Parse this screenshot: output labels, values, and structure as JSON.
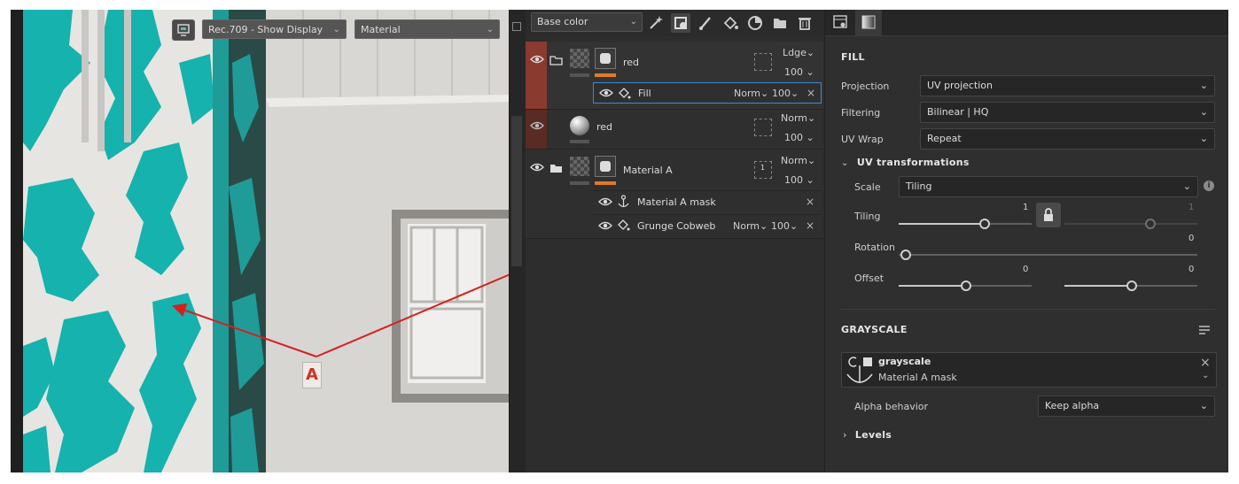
{
  "viewport": {
    "colorspace": "Rec.709 - Show Display",
    "mode": "Material",
    "annotation": "A"
  },
  "layers_panel": {
    "channel": "Base color",
    "layers": [
      {
        "name": "red",
        "blend": "Ldge",
        "opacity": "100",
        "effect": {
          "name": "Fill",
          "blend": "Norm",
          "opacity": "100"
        }
      },
      {
        "name": "red",
        "blend": "Norm",
        "opacity": "100"
      },
      {
        "name": "Material A",
        "blend": "Norm",
        "opacity": "100",
        "mask_count": "1",
        "children": [
          {
            "name": "Material A mask"
          },
          {
            "name": "Grunge Cobweb",
            "blend": "Norm",
            "opacity": "100"
          }
        ]
      }
    ]
  },
  "properties": {
    "fill_title": "FILL",
    "projection_label": "Projection",
    "projection_value": "UV projection",
    "filtering_label": "Filtering",
    "filtering_value": "Bilinear | HQ",
    "uvwrap_label": "UV Wrap",
    "uvwrap_value": "Repeat",
    "uv_transformations_title": "UV transformations",
    "scale_label": "Scale",
    "scale_value": "Tiling",
    "tiling_label": "Tiling",
    "tiling_value": "1",
    "tiling_value_2": "1",
    "rotation_label": "Rotation",
    "rotation_value": "0",
    "offset_label": "Offset",
    "offset_value_1": "0",
    "offset_value_2": "0",
    "grayscale_title": "GRAYSCALE",
    "grayscale_name": "grayscale",
    "grayscale_source": "Material A mask",
    "alpha_behavior_label": "Alpha behavior",
    "alpha_behavior_value": "Keep alpha",
    "levels_title": "Levels"
  },
  "colors": {
    "accent_orange": "#e07b22",
    "teal_paint": "#14b3b0",
    "selection_red": "#8b3a2f",
    "arrow_red": "#d62020"
  }
}
